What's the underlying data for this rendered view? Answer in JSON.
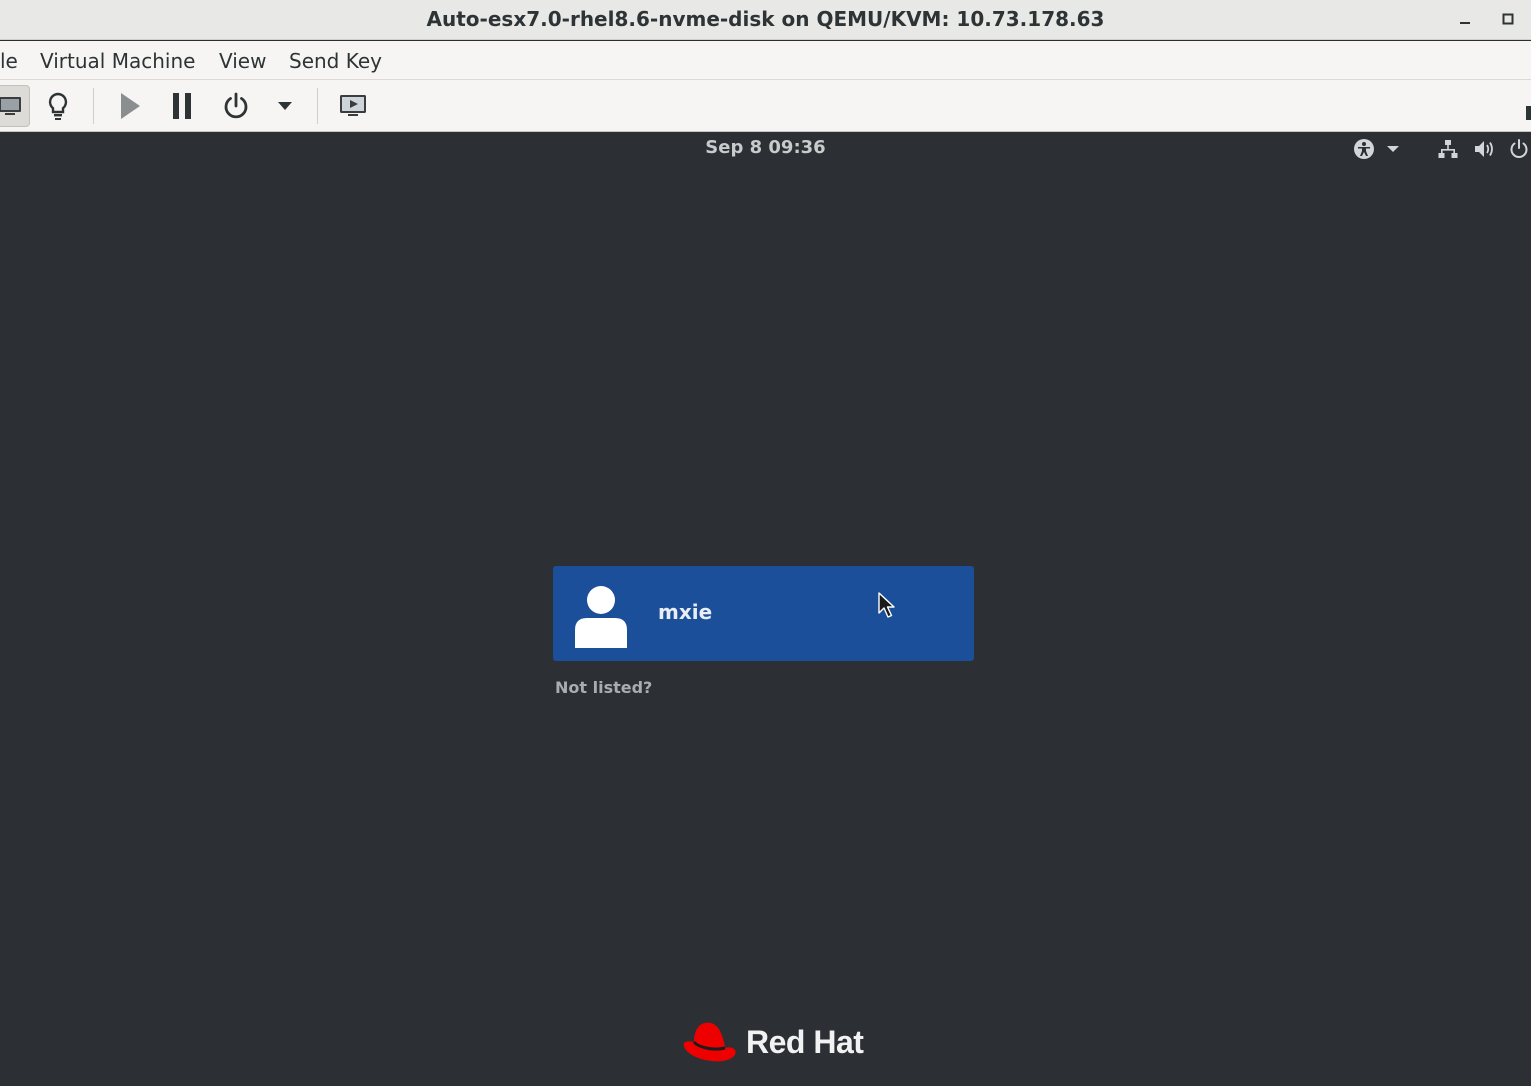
{
  "window": {
    "title": "Auto-esx7.0-rhel8.6-nvme-disk on QEMU/KVM: 10.73.178.63",
    "minimize_label": "–",
    "maximize_label": "□"
  },
  "menu": {
    "items": [
      "le",
      "Virtual Machine",
      "View",
      "Send Key"
    ]
  },
  "toolbar": {
    "buttons": [
      {
        "icon": "monitor-icon",
        "state": "active"
      },
      {
        "icon": "lightbulb-icon"
      },
      {
        "icon": "play-icon"
      },
      {
        "icon": "pause-icon"
      },
      {
        "icon": "power-icon"
      },
      {
        "icon": "chevron-down-icon"
      },
      {
        "icon": "screen-console-icon"
      }
    ]
  },
  "guest": {
    "clock": "Sep 8  09:36",
    "tray_icons": [
      "accessibility-icon",
      "chevron-down-icon",
      "network-icon",
      "volume-icon",
      "power-icon"
    ],
    "user": {
      "name": "mxie",
      "avatar_icon": "user-avatar-icon"
    },
    "not_listed": "Not listed?",
    "brand": "Red Hat"
  },
  "colors": {
    "background": "#2c3034",
    "user_card": "#1b4f9a",
    "brand_red": "#ee0000"
  }
}
